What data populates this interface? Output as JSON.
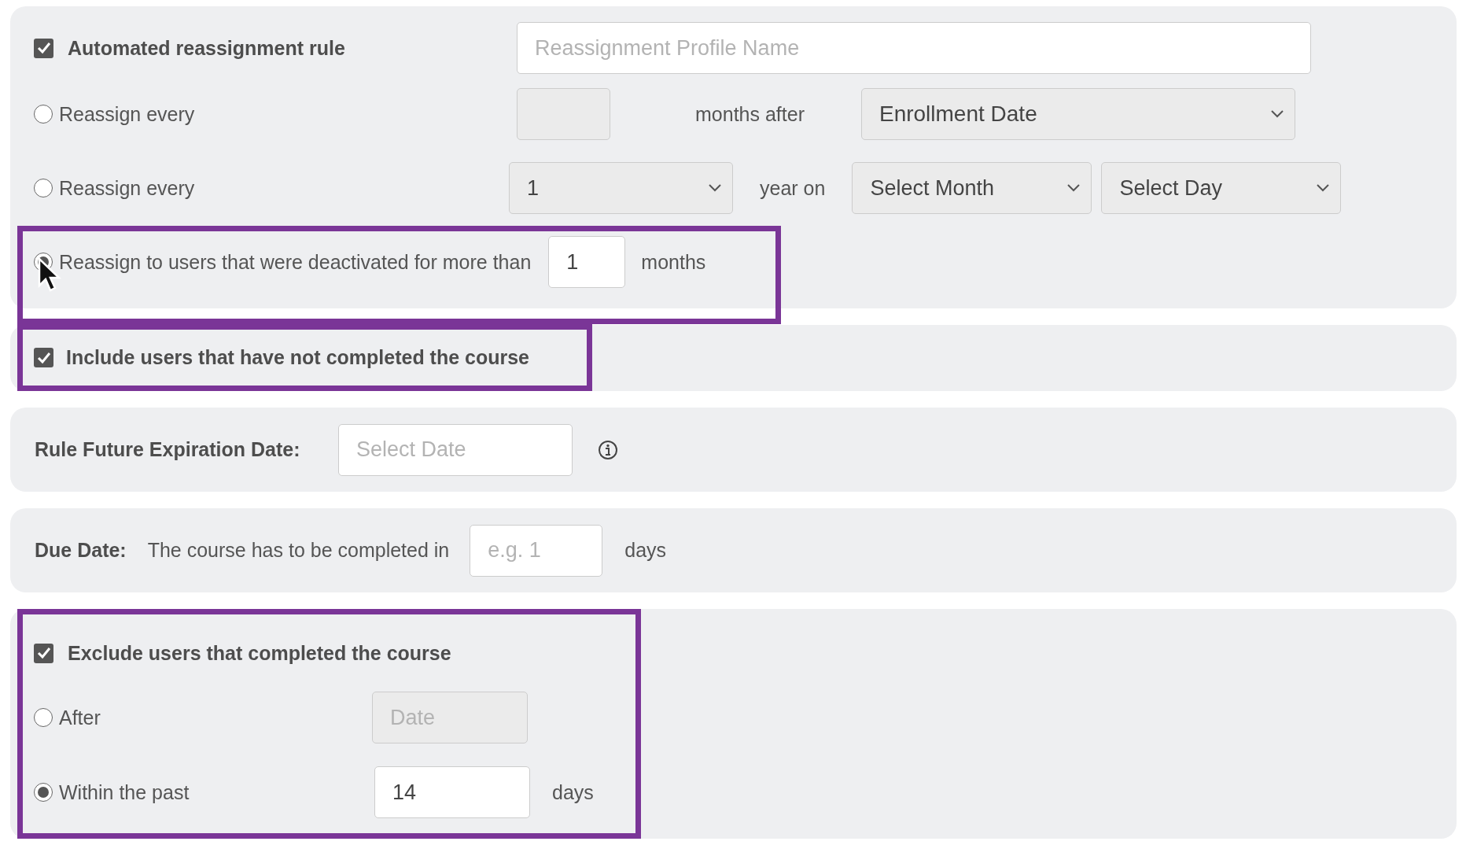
{
  "reassignment_panel": {
    "rule_checkbox": {
      "label": "Automated reassignment rule",
      "checked": true
    },
    "profile_name": {
      "placeholder": "Reassignment Profile Name"
    },
    "options": [
      {
        "kind": "months_after",
        "label": "Reassign every",
        "selected": false,
        "count_field": {
          "disabled": true
        },
        "unit": "months after",
        "select": {
          "value": "Enrollment Date"
        }
      },
      {
        "kind": "yearly",
        "label": "Reassign every",
        "selected": false,
        "year_select": {
          "value": "1"
        },
        "unit": "year on",
        "month_select": {
          "value": "Select Month"
        },
        "day_select": {
          "value": "Select Day"
        }
      },
      {
        "kind": "deactivated",
        "label": "Reassign to users that were deactivated for more than",
        "selected": true,
        "highlighted": true,
        "field": {
          "value": "1"
        },
        "unit": "months"
      }
    ]
  },
  "include_panel": {
    "label": "Include users that have not completed the course",
    "checked": true,
    "highlighted": true
  },
  "expiration_panel": {
    "label": "Rule Future Expiration Date:",
    "field": {
      "placeholder": "Select Date"
    }
  },
  "due_date_panel": {
    "label": "Due Date:",
    "text": "The course has to be completed in",
    "field": {
      "placeholder": "e.g. 1"
    },
    "unit": "days"
  },
  "exclude_panel": {
    "highlighted": true,
    "checkbox": {
      "label": "Exclude users that completed the course",
      "checked": true
    },
    "options": [
      {
        "label": "After",
        "selected": false,
        "field": {
          "placeholder": "Date",
          "disabled": true
        }
      },
      {
        "label": "Within the past",
        "selected": true,
        "field": {
          "value": "14",
          "disabled": false
        },
        "unit": "days"
      }
    ]
  }
}
